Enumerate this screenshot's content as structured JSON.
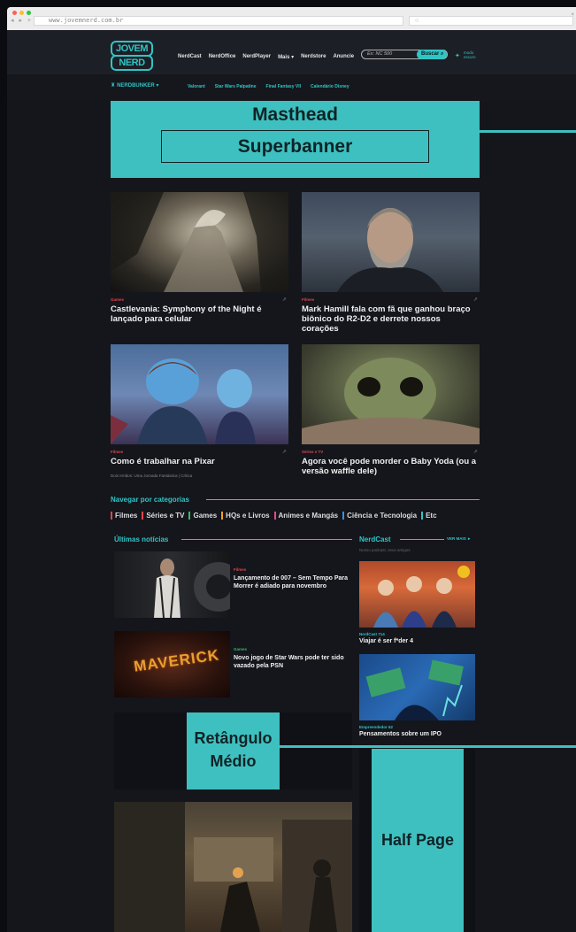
{
  "browser": {
    "url": "www.jovemnerd.com.br",
    "nav_buttons": "◂ ▸ +",
    "search_glyph": "○",
    "close_glyph": "×"
  },
  "header": {
    "logo_line1": "JOVEM",
    "logo_line2": "NERD",
    "nav": [
      "NerdCast",
      "NerdOffice",
      "NerdPlayer",
      "Mais ▾",
      "Nerdstore",
      "Anuncie"
    ],
    "search_placeholder": "Ex: NC 500",
    "search_button": "Buscar",
    "mode_line1": "modo",
    "mode_line2": "escuro"
  },
  "subnav": {
    "brand": "NERDBUNKER ▾",
    "trending": [
      "Valorant",
      "Star Wars Palpatine",
      "Final Fantasy VII",
      "Calendário Disney"
    ]
  },
  "ads": {
    "masthead": "Masthead",
    "superbanner": "Superbanner",
    "rect_line1": "Retângulo",
    "rect_line2": "Médio",
    "halfpage": "Half Page"
  },
  "featured": [
    {
      "category": "Games",
      "title": "Castlevania: Symphony of the Night é lançado para celular"
    },
    {
      "category": "Filmes",
      "title": "Mark Hamill fala com fã que ganhou braço biônico do R2-D2 e derrete nossos corações"
    },
    {
      "category": "Filmes",
      "title": "Como é trabalhar na Pixar",
      "sub": "Dois Irmãos: Uma Jornada Fantástica | Crítica"
    },
    {
      "category": "Séries e TV",
      "title": "Agora você pode morder o Baby Yoda (ou a versão waffle dele)"
    }
  ],
  "categories": {
    "title": "Navegar por categorias",
    "items": [
      "Filmes",
      "Séries e TV",
      "Games",
      "HQs e Livros",
      "Animes e Mangás",
      "Ciência e Tecnologia",
      "Etc"
    ],
    "colors": [
      "#e0464e",
      "#e0464e",
      "#3fb56a",
      "#f0a020",
      "#e04c8c",
      "#3a8fe0",
      "#2fc5c5"
    ]
  },
  "latest": {
    "title": "Últimas notícias",
    "items": [
      {
        "category": "Filmes",
        "title": "Lançamento de 007 – Sem Tempo Para Morrer é adiado para novembro"
      },
      {
        "category": "Games",
        "title": "Novo jogo de Star Wars pode ter sido vazado pela PSN",
        "thumb_text": "MAVERICK"
      }
    ]
  },
  "nerdcast": {
    "title": "NerdCast",
    "see_more": "VER MAIS ►",
    "subtitle": "Nosso podcast, seus amigos",
    "items": [
      {
        "category": "NerdCast 714",
        "title": "Viajar é ser f*der 4"
      },
      {
        "category": "Empreendedor 62",
        "title": "Pensamentos sobre um IPO"
      }
    ]
  }
}
